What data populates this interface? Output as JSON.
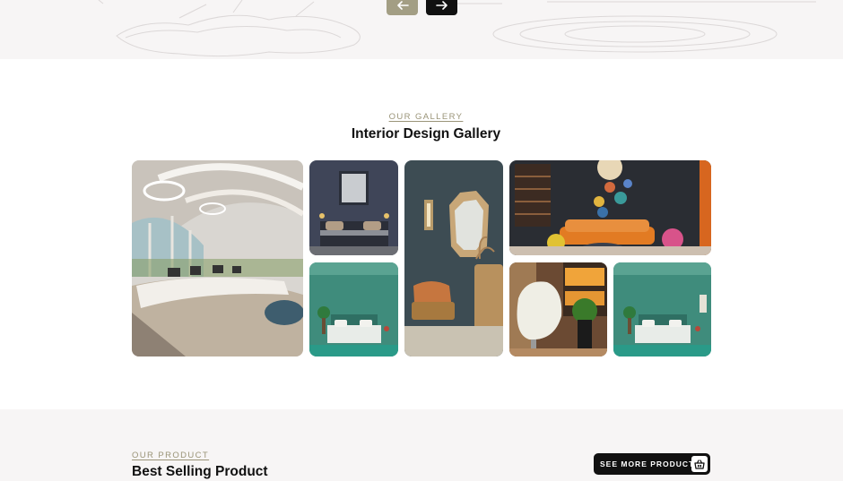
{
  "hero": {
    "prev_icon": "arrow-left-icon",
    "next_icon": "arrow-right-icon",
    "colors": {
      "prev_bg": "#a39e84",
      "next_bg": "#111111",
      "strip_bg": "#f7f5f5"
    }
  },
  "gallery": {
    "eyebrow": "OUR GALLERY",
    "title": "Interior Design Gallery",
    "images": [
      "futuristic-office",
      "navy-bedroom",
      "green-bedroom",
      "wall-mirror-armchair",
      "colorful-living-room",
      "egg-chair-corner",
      "green-bedroom"
    ]
  },
  "product": {
    "eyebrow": "OUR PRODUCT",
    "title": "Best Selling Product",
    "cta_label": "SEE MORE PRODUCT",
    "cta_icon": "basket-icon"
  },
  "colors": {
    "accent": "#9a9478",
    "dark": "#111111"
  }
}
